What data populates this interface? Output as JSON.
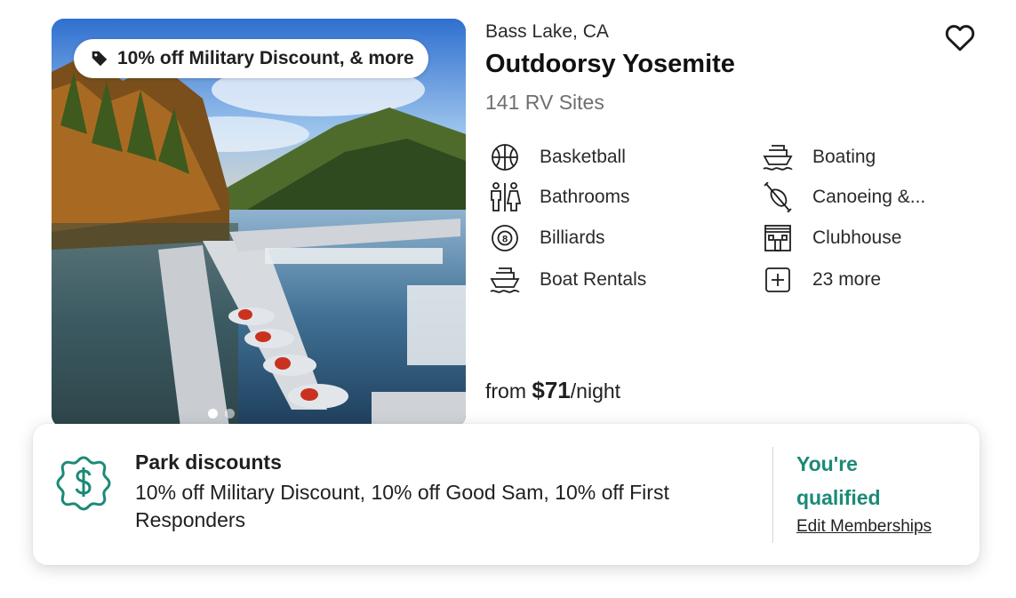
{
  "listing": {
    "promo_tag": "10% off Military Discount, & more",
    "location": "Bass Lake, CA",
    "title": "Outdoorsy Yosemite",
    "sites": "141 RV Sites",
    "favorite_icon": "heart-outline-icon",
    "gallery": {
      "slides_shown": 2,
      "active_slide": 1
    },
    "amenities": [
      {
        "label": "Basketball",
        "icon": "basketball-icon"
      },
      {
        "label": "Boating",
        "icon": "boat-icon"
      },
      {
        "label": "Bathrooms",
        "icon": "restroom-icon"
      },
      {
        "label": "Canoeing &...",
        "icon": "canoe-icon"
      },
      {
        "label": "Billiards",
        "icon": "billiard-ball-icon"
      },
      {
        "label": "Clubhouse",
        "icon": "clubhouse-icon"
      },
      {
        "label": "Boat Rentals",
        "icon": "boat-icon"
      },
      {
        "label": "23 more",
        "icon": "plus-square-icon"
      }
    ],
    "price": {
      "prefix": "from ",
      "amount": "$71",
      "suffix": "/night"
    }
  },
  "discounts": {
    "icon": "dollar-badge-icon",
    "title": "Park discounts",
    "text": "10% off Military Discount, 10% off Good Sam, 10% off First Responders",
    "qualified": "You're qualified",
    "edit_link": "Edit Memberships"
  },
  "colors": {
    "accent": "#1b8a76",
    "text": "#1f1f1f",
    "muted": "#6f6f6f"
  }
}
